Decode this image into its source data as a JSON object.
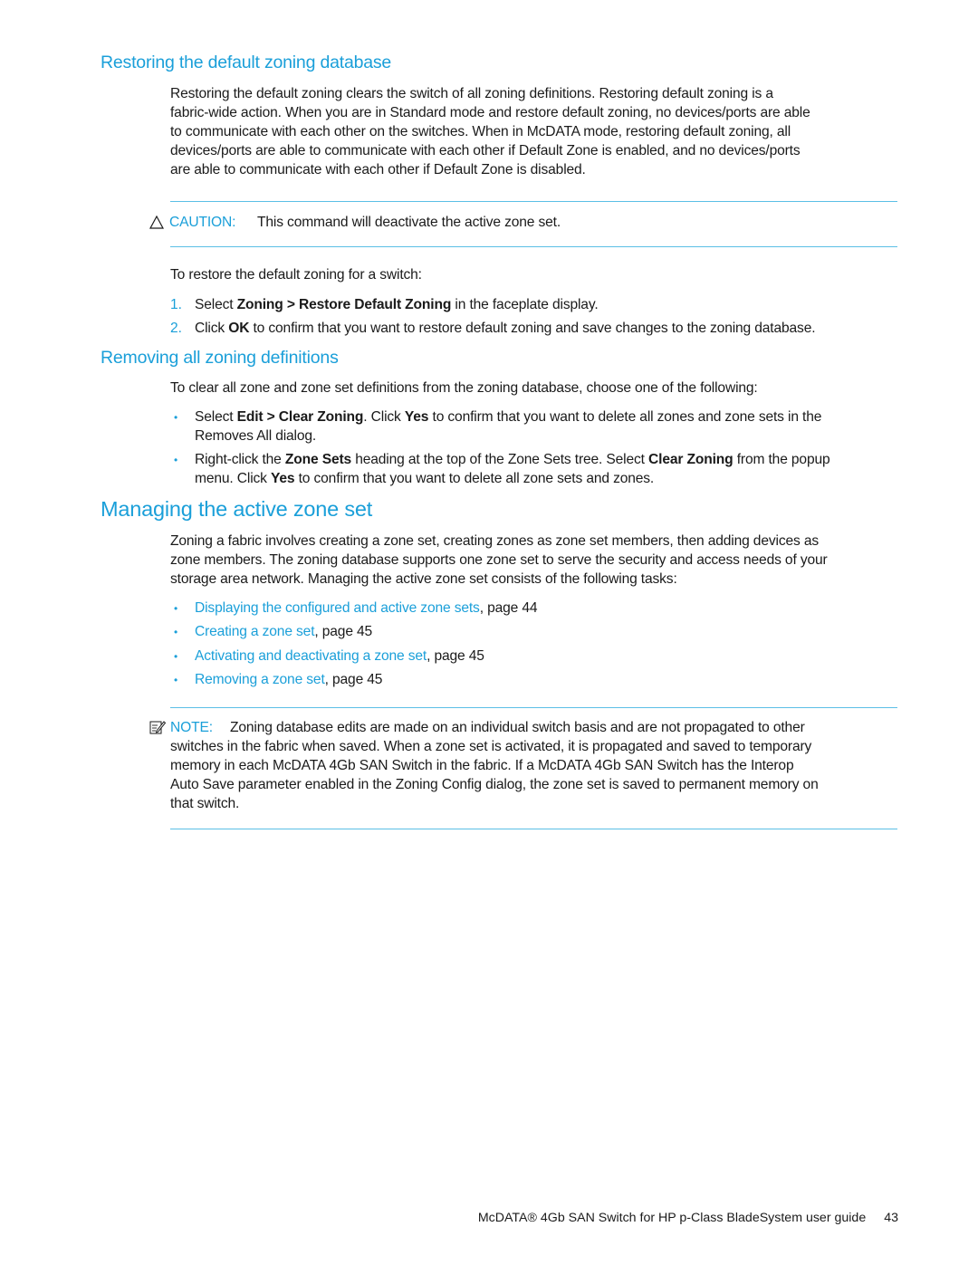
{
  "section_restore": {
    "heading": "Restoring the default zoning database",
    "intro_lines": [
      "Restoring the default zoning clears the switch of all zoning definitions. Restoring default zoning is a",
      "fabric-wide action. When you are in Standard mode and restore default zoning, no devices/ports are able",
      "to communicate with each other on the switches. When in McDATA mode, restoring default zoning, all",
      "devices/ports are able to communicate with each other if Default Zone is enabled, and no devices/ports",
      "are able to communicate with each other if Default Zone is disabled."
    ],
    "caution": {
      "icon": "caution-triangle-icon",
      "label": "CAUTION:",
      "text": "This command will deactivate the active zone set."
    },
    "steps_intro": "To restore the default zoning for a switch:",
    "steps": [
      {
        "number": "1.",
        "pre": "Select ",
        "bold": "Zoning > Restore Default Zoning",
        "post": " in the faceplate display."
      },
      {
        "number": "2.",
        "pre": "Click ",
        "bold": "OK",
        "post": " to confirm that you want to restore default zoning and save changes to the zoning database."
      }
    ]
  },
  "section_remove": {
    "heading": "Removing all zoning definitions",
    "intro": "To clear all zone and zone set definitions from the zoning database, choose one of the following:",
    "bullets": [
      {
        "t1": "Select ",
        "b1": "Edit > Clear Zoning",
        "t2": ". Click ",
        "b2": "Yes",
        "t3": " to confirm that you want to delete all zones and zone sets in the",
        "line2": "Removes All dialog."
      },
      {
        "t1": "Right-click the ",
        "b1": "Zone Sets",
        "t2": " heading at the top of the Zone Sets tree. Select ",
        "b2": "Clear Zoning",
        "t3": " from the popup",
        "line2_pre": "menu. Click ",
        "line2_bold": "Yes",
        "line2_post": " to confirm that you want to delete all zone sets and zones."
      }
    ]
  },
  "section_manage": {
    "heading": "Managing the active zone set",
    "intro_lines": [
      "Zoning a fabric involves creating a zone set, creating zones as zone set members, then adding devices as",
      "zone members. The zoning database supports one zone set to serve the security and access needs of your",
      "storage area network. Managing the active zone set consists of the following tasks:"
    ],
    "tasks": [
      {
        "link": "Displaying the configured and active zone sets",
        "page": ", page 44"
      },
      {
        "link": "Creating a zone set",
        "page": ", page 45"
      },
      {
        "link": "Activating and deactivating a zone set",
        "page": ", page 45"
      },
      {
        "link": "Removing a zone set",
        "page": ", page 45"
      }
    ],
    "note": {
      "icon": "note-pencil-icon",
      "label": "NOTE:",
      "first_line": "Zoning database edits are made on an individual switch basis and are not propagated to other",
      "lines": [
        "switches in the fabric when saved. When a zone set is activated, it is propagated and saved to temporary",
        "memory in each McDATA 4Gb SAN Switch in the fabric. If a McDATA 4Gb SAN Switch has the Interop",
        "Auto Save parameter enabled in the Zoning Config dialog, the zone set is saved to permanent memory on",
        "that switch."
      ]
    }
  },
  "footer": {
    "title": "McDATA® 4Gb SAN Switch for HP p-Class BladeSystem user guide",
    "page_number": "43"
  },
  "colors": {
    "accent": "#1a9fd9",
    "rule": "#5bbfe6",
    "text": "#1a1a1a"
  }
}
